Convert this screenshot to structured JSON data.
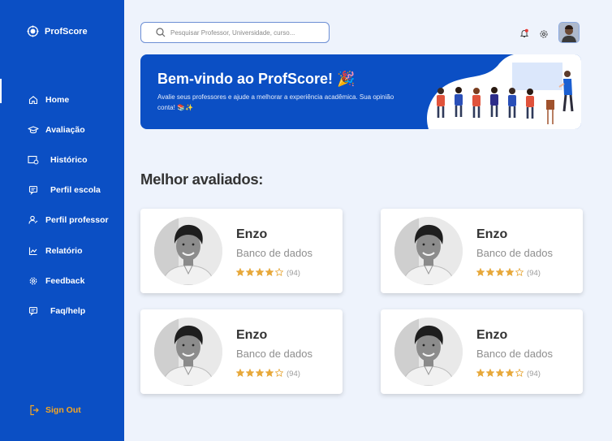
{
  "app": {
    "name": "ProfScore"
  },
  "sidebar": {
    "items": [
      {
        "label": "Home",
        "icon": "home-icon"
      },
      {
        "label": "Avaliação",
        "icon": "graduation-cap-icon"
      },
      {
        "label": "Histórico",
        "icon": "history-icon"
      },
      {
        "label": "Perfil escola",
        "icon": "school-profile-icon"
      },
      {
        "label": "Perfil professor",
        "icon": "teacher-profile-icon"
      },
      {
        "label": "Relatório",
        "icon": "report-chart-icon"
      },
      {
        "label": "Feedback",
        "icon": "feedback-gear-icon"
      },
      {
        "label": "Faq/help",
        "icon": "help-chat-icon"
      }
    ],
    "signout_label": "Sign Out"
  },
  "search": {
    "placeholder": "Pesquisar Professor, Universidade, curso..."
  },
  "banner": {
    "title": "Bem-vindo ao ProfScore! 🎉",
    "subtitle": "Avalie seus professores e ajude a melhorar a experiência acadêmica. Sua opinião conta! 📚✨"
  },
  "section": {
    "title": "Melhor avaliados:"
  },
  "cards": [
    {
      "name": "Enzo",
      "subject": "Banco de dados",
      "stars": 4,
      "max_stars": 5,
      "count": "(94)"
    },
    {
      "name": "Enzo",
      "subject": "Banco de dados",
      "stars": 4,
      "max_stars": 5,
      "count": "(94)"
    },
    {
      "name": "Enzo",
      "subject": "Banco de dados",
      "stars": 4,
      "max_stars": 5,
      "count": "(94)"
    },
    {
      "name": "Enzo",
      "subject": "Banco de dados",
      "stars": 4,
      "max_stars": 5,
      "count": "(94)"
    }
  ],
  "colors": {
    "primary": "#0b4fc4",
    "accent": "#f5a623",
    "background": "#eef3fc",
    "star": "#e7a83a"
  }
}
